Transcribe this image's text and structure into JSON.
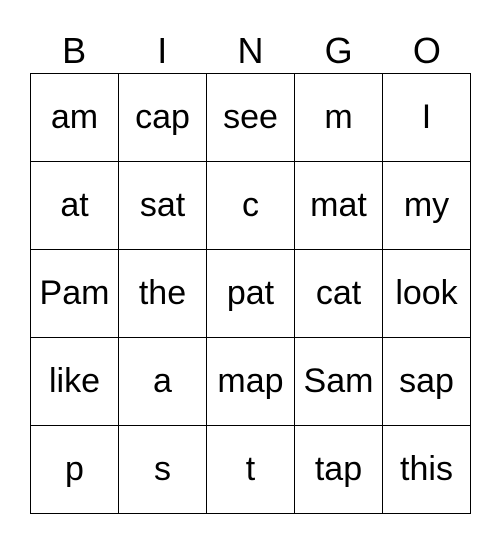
{
  "header": [
    "B",
    "I",
    "N",
    "G",
    "O"
  ],
  "cells": [
    [
      "am",
      "cap",
      "see",
      "m",
      "I"
    ],
    [
      "at",
      "sat",
      "c",
      "mat",
      "my"
    ],
    [
      "Pam",
      "the",
      "pat",
      "cat",
      "look"
    ],
    [
      "like",
      "a",
      "map",
      "Sam",
      "sap"
    ],
    [
      "p",
      "s",
      "t",
      "tap",
      "this"
    ]
  ]
}
